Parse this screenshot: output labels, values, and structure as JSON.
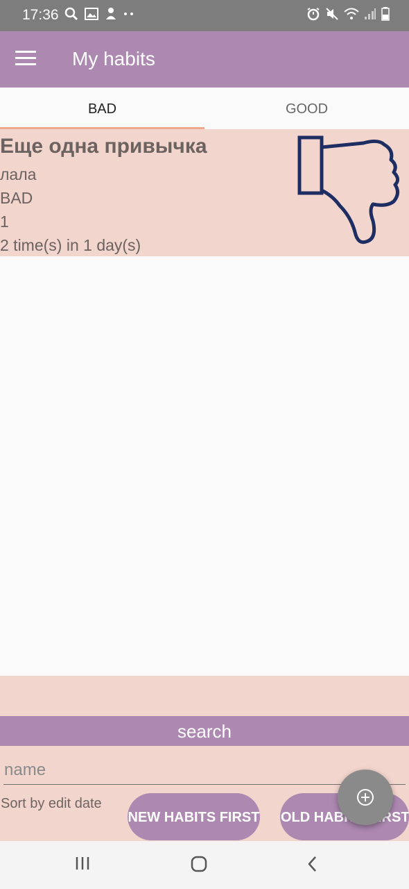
{
  "status_bar": {
    "time": "17:36",
    "left_icons": [
      "search-icon",
      "image-icon",
      "notification-icon",
      "more-dots-icon"
    ],
    "right_icons": [
      "alarm-icon",
      "mute-icon",
      "wifi-icon",
      "signal-icon",
      "battery-icon"
    ]
  },
  "app_bar": {
    "title": "My habits",
    "menu_icon": "hamburger-menu-icon"
  },
  "tabs": [
    {
      "label": "BAD",
      "selected": true
    },
    {
      "label": "GOOD",
      "selected": false
    }
  ],
  "colors": {
    "accent": "#ad88b1",
    "card_background": "#f2d5cc",
    "tab_indicator": "#efa98f",
    "thumbs_icon": "#1e2d62"
  },
  "habits": [
    {
      "name": "Еще одна привычка",
      "description": "лала",
      "type": "BAD",
      "priority": "1",
      "frequency": "2 time(s) in 1 day(s)",
      "icon": "thumbs-down-icon"
    }
  ],
  "bottom_sheet": {
    "search_title": "search",
    "name_placeholder": "name",
    "sort_label": "Sort by edit date",
    "new_first_label": "NEW HABITS FIRST",
    "old_first_label": "OLD HABITS FIRST"
  },
  "fab": {
    "icon": "add-circle-icon"
  },
  "nav_bar": {
    "icons": [
      "recent-apps-icon",
      "home-icon",
      "back-icon"
    ]
  }
}
